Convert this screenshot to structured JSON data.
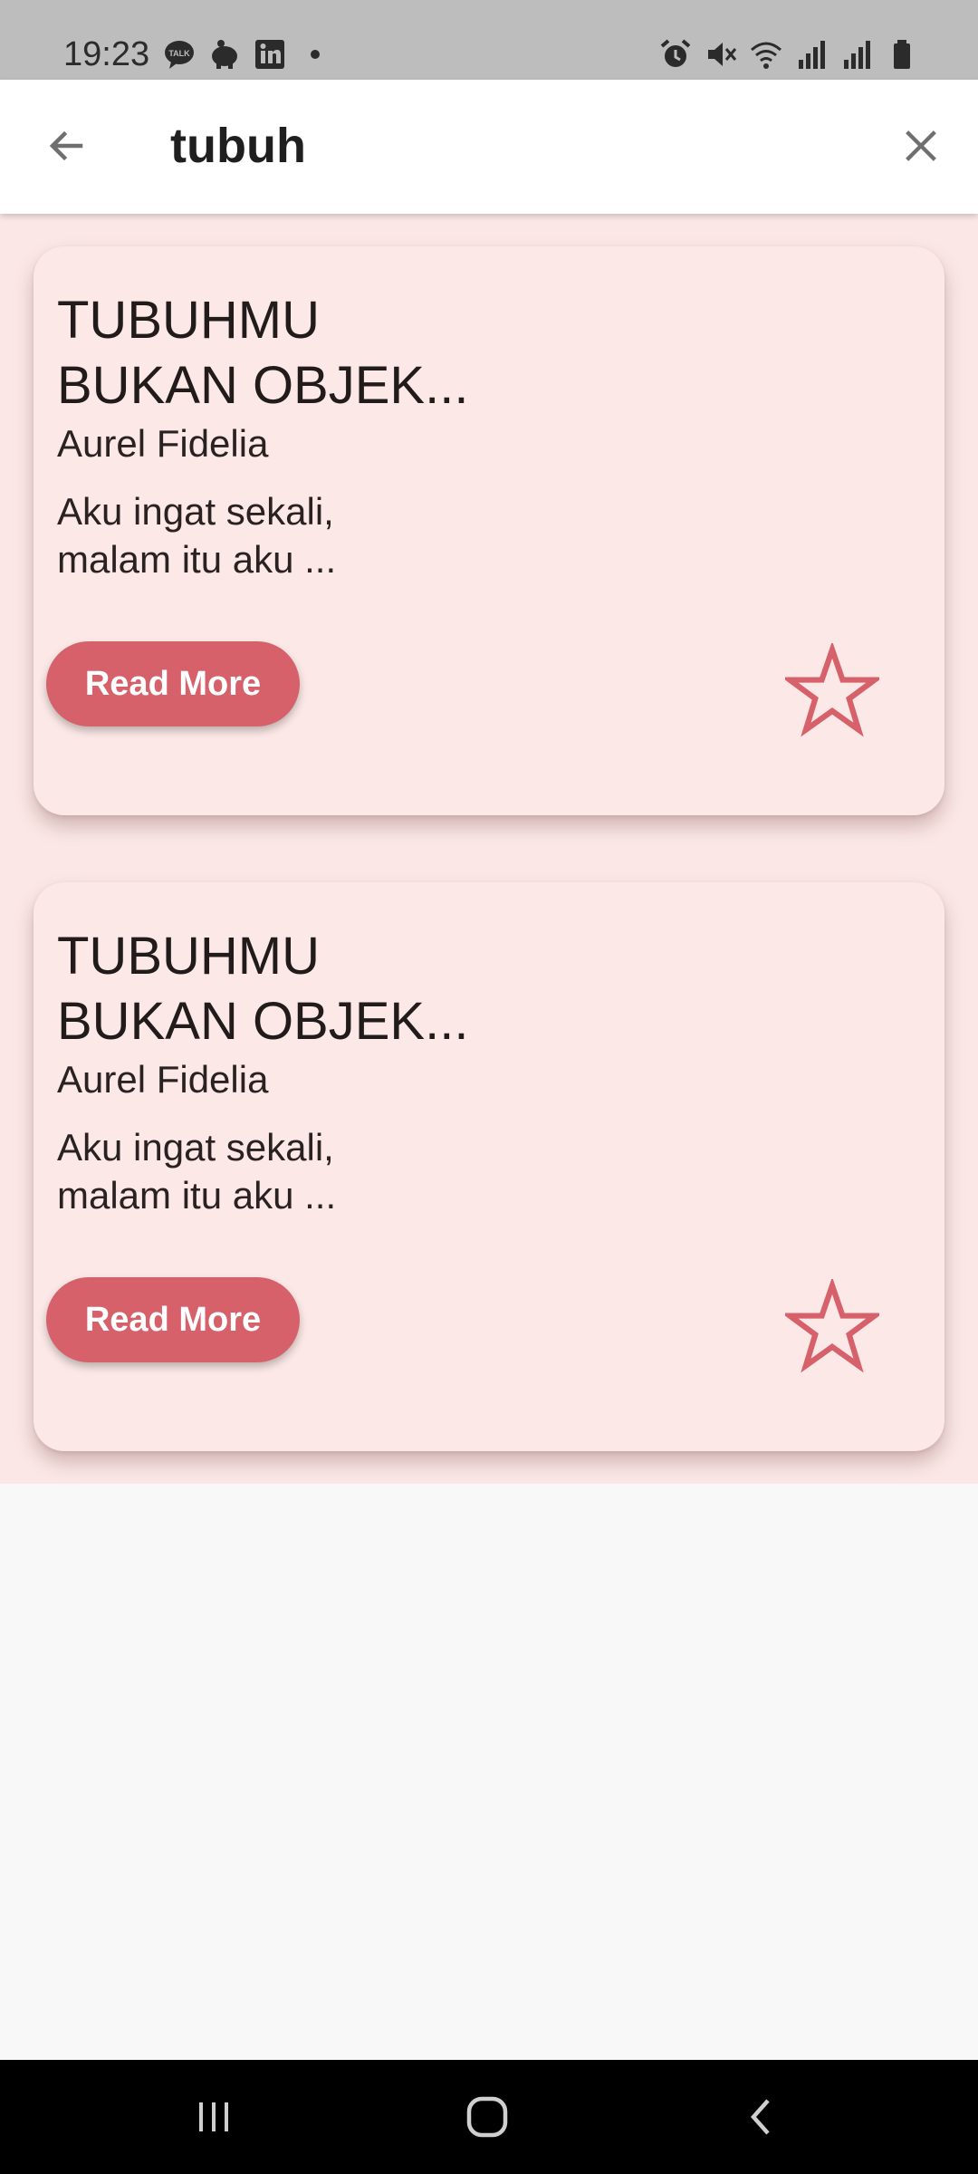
{
  "status_bar": {
    "time": "19:23",
    "left_icons": [
      "kakaotalk-icon",
      "piggy-bank-icon",
      "linkedin-icon",
      "notification-dot-icon"
    ],
    "right_icons": [
      "alarm-icon",
      "mute-icon",
      "wifi-icon",
      "signal-icon",
      "signal-icon",
      "battery-icon"
    ]
  },
  "search": {
    "query": "tubuh",
    "back_icon": "arrow-left-icon",
    "clear_icon": "close-icon"
  },
  "results": [
    {
      "title_line1": "TUBUHMU",
      "title_line2": "BUKAN OBJEK...",
      "author": "Aurel Fidelia",
      "excerpt_line1": "Aku ingat sekali,",
      "excerpt_line2": "malam itu aku ...",
      "button_label": "Read More",
      "favorite_icon": "star-outline-icon"
    },
    {
      "title_line1": "TUBUHMU",
      "title_line2": "BUKAN OBJEK...",
      "author": "Aurel Fidelia",
      "excerpt_line1": "Aku ingat sekali,",
      "excerpt_line2": "malam itu aku ...",
      "button_label": "Read More",
      "favorite_icon": "star-outline-icon"
    }
  ],
  "nav_bar": {
    "icons": [
      "recent-apps-icon",
      "home-icon",
      "back-icon"
    ]
  },
  "colors": {
    "accent": "#d7616a",
    "card_background": "#fce9e7",
    "list_background": "#fbe8e6",
    "status_bar": "#bdbdbd"
  }
}
